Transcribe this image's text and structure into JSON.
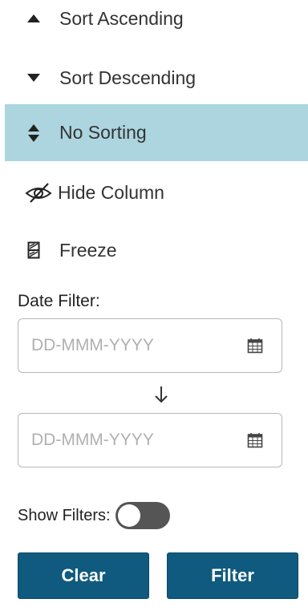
{
  "menu": {
    "items": [
      {
        "label": "Sort Ascending",
        "icon": "caret-up-icon",
        "active": false
      },
      {
        "label": "Sort Descending",
        "icon": "caret-down-icon",
        "active": false
      },
      {
        "label": "No Sorting",
        "icon": "sort-both-icon",
        "active": true
      },
      {
        "label": "Hide Column",
        "icon": "eye-slash-icon",
        "active": false
      },
      {
        "label": "Freeze",
        "icon": "freeze-icon",
        "active": false
      }
    ]
  },
  "date_filter": {
    "label": "Date Filter:",
    "from": {
      "value": "",
      "placeholder": "DD-MMM-YYYY"
    },
    "to": {
      "value": "",
      "placeholder": "DD-MMM-YYYY"
    },
    "arrow_icon": "arrow-down-icon",
    "calendar_icon": "calendar-icon"
  },
  "show_filters": {
    "label": "Show Filters:",
    "enabled": false
  },
  "buttons": {
    "clear_label": "Clear",
    "filter_label": "Filter"
  },
  "colors": {
    "active_row": "#acd5df",
    "primary_button": "#0f5a7e",
    "toggle_off": "#555555"
  }
}
